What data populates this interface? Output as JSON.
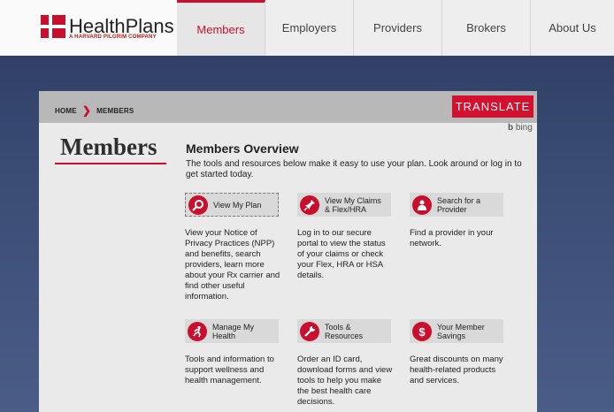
{
  "brand": {
    "name": "HealthPlans",
    "tagline": "A HARVARD PILGRIM COMPANY",
    "accent": "#c8102e"
  },
  "nav": [
    {
      "label": "Members",
      "active": true
    },
    {
      "label": "Employers",
      "active": false
    },
    {
      "label": "Providers",
      "active": false
    },
    {
      "label": "Brokers",
      "active": false
    },
    {
      "label": "About Us",
      "active": false
    }
  ],
  "breadcrumb": {
    "home": "HOME",
    "current": "MEMBERS"
  },
  "translate_label": "TRANSLATE",
  "bing_label": "bing",
  "page_title": "Members",
  "overview": {
    "heading": "Members Overview",
    "text": "The tools and resources below make it easy to use your plan. Look around or log in to get started today."
  },
  "tiles": [
    {
      "label": "View My Plan",
      "icon": "search-icon",
      "desc": "View your Notice of Privacy Practices (NPP) and benefits, search providers, learn more about your Rx carrier and find other useful information."
    },
    {
      "label": "View My Claims & Flex/HRA",
      "icon": "pin-icon",
      "desc": "Log in to our secure portal to view the status of your claims or check your Flex, HRA or HSA details."
    },
    {
      "label": "Search for a Provider",
      "icon": "doctor-icon",
      "desc": "Find a provider in your network."
    },
    {
      "label": "Manage My Health",
      "icon": "runner-icon",
      "desc": "Tools and information to support wellness and health management."
    },
    {
      "label": "Tools & Resources",
      "icon": "wrench-icon",
      "desc": "Order an ID card, download forms and view tools to help you make the best health care decisions."
    },
    {
      "label": "Your Member Savings",
      "icon": "dollar-icon",
      "desc": "Great discounts on many health-related products and services."
    }
  ]
}
